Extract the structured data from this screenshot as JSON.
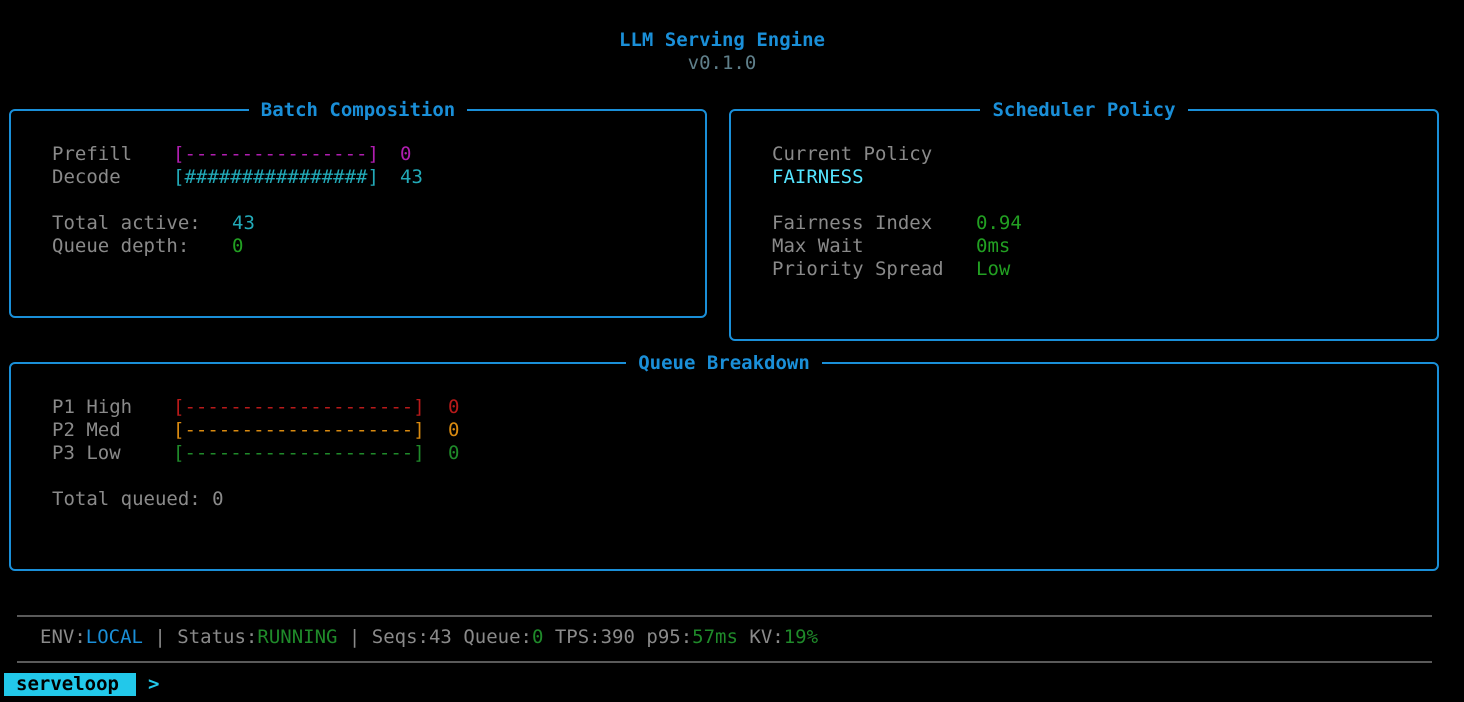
{
  "header": {
    "title": "LLM Serving Engine",
    "version": "v0.1.0"
  },
  "batch": {
    "title": "Batch Composition",
    "prefill_label": "Prefill",
    "prefill_bar": "[----------------]",
    "prefill_value": "0",
    "decode_label": "Decode",
    "decode_bar": "[################]",
    "decode_value": "43",
    "total_active_label": "Total active:",
    "total_active_value": "43",
    "queue_depth_label": "Queue depth:",
    "queue_depth_value": "0"
  },
  "scheduler": {
    "title": "Scheduler Policy",
    "current_policy_label": "Current Policy",
    "current_policy_value": "FAIRNESS",
    "fairness_label": "Fairness Index",
    "fairness_value": "0.94",
    "max_wait_label": "Max Wait",
    "max_wait_value": "0ms",
    "priority_spread_label": "Priority Spread",
    "priority_spread_value": "Low"
  },
  "queue": {
    "title": "Queue Breakdown",
    "rows": [
      {
        "label": "P1 High",
        "bar": "[--------------------]",
        "value": "0"
      },
      {
        "label": "P2 Med",
        "bar": "[--------------------]",
        "value": "0"
      },
      {
        "label": "P3 Low",
        "bar": "[--------------------]",
        "value": "0"
      }
    ],
    "total_label": "Total queued: 0"
  },
  "status": {
    "env_label": "ENV:",
    "env_value": "LOCAL",
    "sep": " | ",
    "status_label": "Status:",
    "status_value": "RUNNING",
    "seqs": "Seqs:43",
    "queue_label": "Queue:",
    "queue_value": "0",
    "tps": "TPS:390",
    "p95_label": "p95:",
    "p95_value": "57ms",
    "kv_label": "KV:",
    "kv_value": "19%"
  },
  "prompt": {
    "name": "serveloop",
    "caret": ">"
  },
  "colors": {
    "accent": "#1a8fd8",
    "prefill": "#b01eb0",
    "decode": "#22aab8",
    "ok": "#22a022",
    "p1": "#b81a1a",
    "p2": "#d98a10",
    "p3": "#1f8a2a",
    "prompt_bg": "#22c8ea"
  }
}
